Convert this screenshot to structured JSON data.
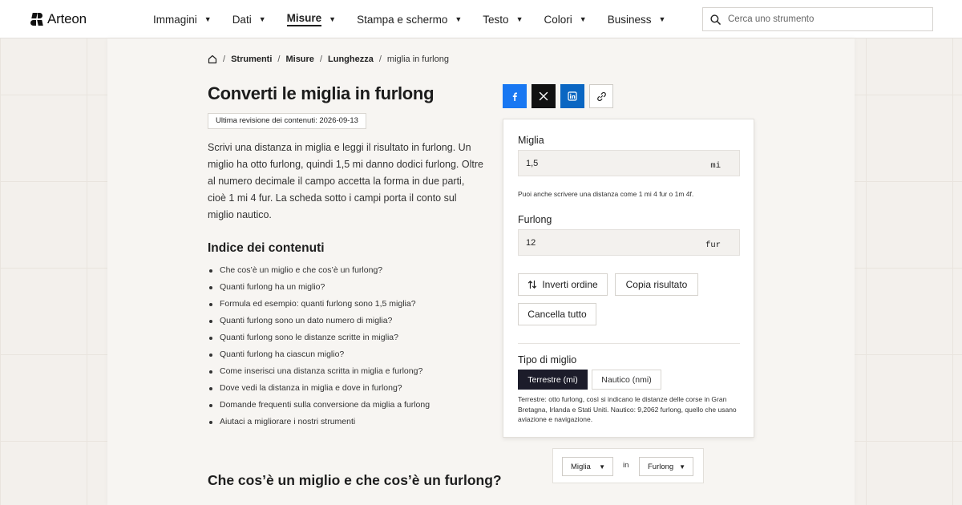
{
  "brand": {
    "name": "Arteon"
  },
  "nav": {
    "items": [
      {
        "label": "Immagini",
        "active": false
      },
      {
        "label": "Dati",
        "active": false
      },
      {
        "label": "Misure",
        "active": true
      },
      {
        "label": "Stampa e schermo",
        "active": false
      },
      {
        "label": "Testo",
        "active": false
      },
      {
        "label": "Colori",
        "active": false
      },
      {
        "label": "Business",
        "active": false
      }
    ]
  },
  "search": {
    "placeholder": "Cerca uno strumento"
  },
  "breadcrumb": {
    "items": [
      "Strumenti",
      "Misure",
      "Lunghezza"
    ],
    "current": "miglia in furlong"
  },
  "page": {
    "title": "Converti le miglia in furlong",
    "revision": "Ultima revisione dei contenuti: 2026-09-13",
    "intro": "Scrivi una distanza in miglia e leggi il risultato in furlong. Un miglio ha otto furlong, quindi 1,5 mi danno dodici furlong. Oltre al numero decimale il campo accetta la forma in due parti, cioè 1 mi 4 fur. La scheda sotto i campi porta il conto sul miglio nautico."
  },
  "toc": {
    "title": "Indice dei contenuti",
    "items": [
      "Che cos’è un miglio e che cos’è un furlong?",
      "Quanti furlong ha un miglio?",
      "Formula ed esempio: quanti furlong sono 1,5 miglia?",
      "Quanti furlong sono un dato numero di miglia?",
      "Quanti furlong sono le distanze scritte in miglia?",
      "Quanti furlong ha ciascun miglio?",
      "Come inserisci una distanza scritta in miglia e furlong?",
      "Dove vedi la distanza in miglia e dove in furlong?",
      "Domande frequenti sulla conversione da miglia a furlong",
      "Aiutaci a migliorare i nostri strumenti"
    ]
  },
  "section": {
    "title": "Che cos’è un miglio e che cos’è un furlong?"
  },
  "share": {
    "icons": [
      "facebook-icon",
      "x-icon",
      "linkedin-icon",
      "link-icon"
    ]
  },
  "converter": {
    "miles": {
      "label": "Miglia",
      "value": "1,5",
      "unit": "mi"
    },
    "hint": "Puoi anche scrivere una distanza come 1 mi 4 fur o 1m 4f.",
    "furlong": {
      "label": "Furlong",
      "value": "12",
      "unit": "fur"
    },
    "buttons": {
      "swap": "Inverti ordine",
      "copy": "Copia risultato",
      "clear": "Cancella tutto"
    },
    "mile_type": {
      "label": "Tipo di miglio",
      "options": [
        "Terrestre (mi)",
        "Nautico (nmi)"
      ],
      "selected": "Terrestre (mi)",
      "description": "Terrestre: otto furlong, così si indicano le distanze delle corse in Gran Bretagna, Irlanda e Stati Uniti. Nautico: 9,2062 furlong, quello che usano aviazione e navigazione."
    }
  },
  "unit_selector": {
    "from": "Miglia",
    "connector": "in",
    "to": "Furlong"
  },
  "colors": {
    "facebook": "#1877f2",
    "x": "#111111",
    "linkedin": "#0a66c2",
    "active_segment": "#1c1c2a"
  }
}
